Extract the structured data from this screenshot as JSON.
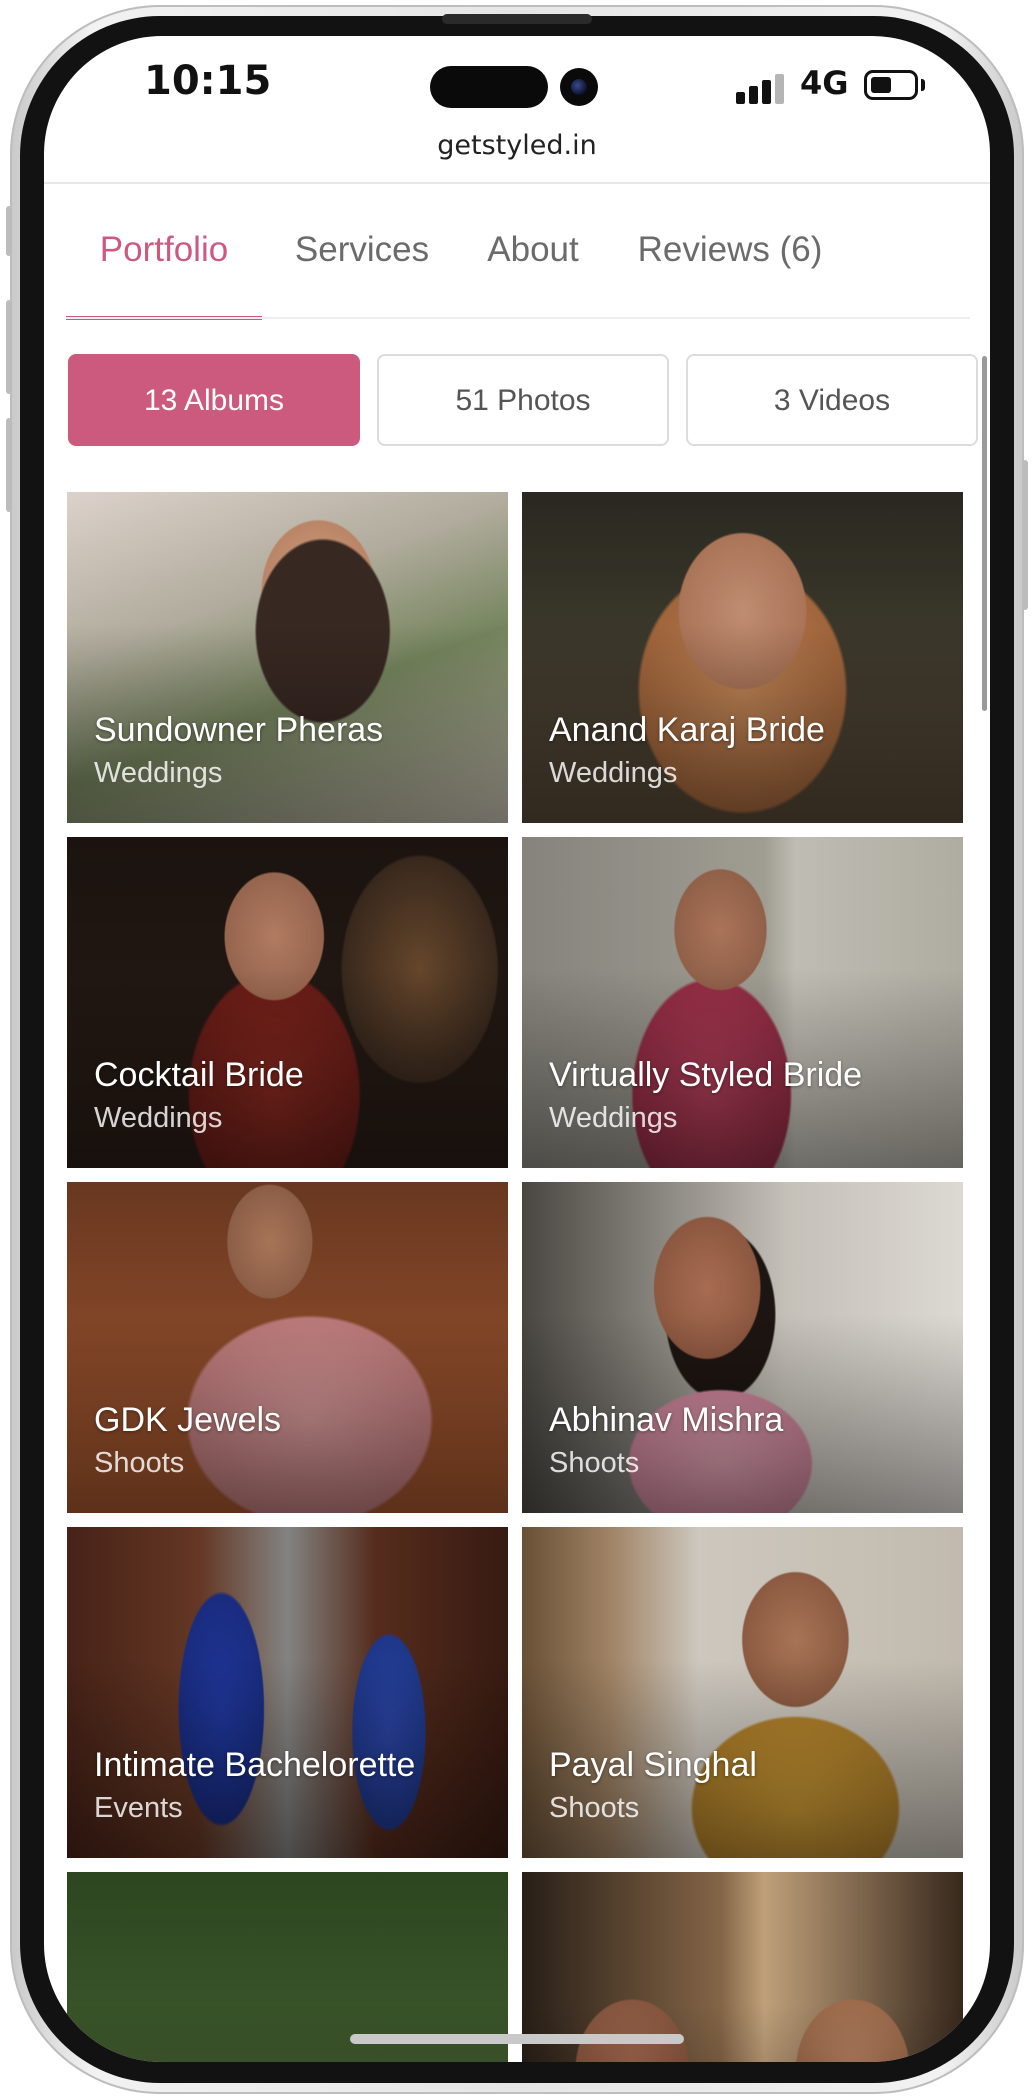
{
  "status_bar": {
    "time": "10:15",
    "network": "4G"
  },
  "browser": {
    "url": "getstyled.in"
  },
  "tabs": [
    {
      "label": "Portfolio",
      "active": true
    },
    {
      "label": "Services",
      "active": false
    },
    {
      "label": "About",
      "active": false
    },
    {
      "label": "Reviews (6)",
      "active": false
    }
  ],
  "segments": [
    {
      "label": "13  Albums",
      "active": true
    },
    {
      "label": "51 Photos",
      "active": false
    },
    {
      "label": "3 Videos",
      "active": false
    }
  ],
  "albums": [
    {
      "title": "Sundowner Pheras",
      "category": "Weddings"
    },
    {
      "title": "Anand Karaj Bride",
      "category": "Weddings"
    },
    {
      "title": "Cocktail Bride",
      "category": "Weddings"
    },
    {
      "title": "Virtually Styled Bride",
      "category": "Weddings"
    },
    {
      "title": "GDK Jewels",
      "category": "Shoots"
    },
    {
      "title": "Abhinav Mishra",
      "category": "Shoots"
    },
    {
      "title": "Intimate Bachelorette",
      "category": "Events"
    },
    {
      "title": "Payal Singhal",
      "category": "Shoots"
    },
    {
      "title": "",
      "category": ""
    },
    {
      "title": "",
      "category": ""
    }
  ],
  "colors": {
    "accent": "#cc5a7f"
  }
}
